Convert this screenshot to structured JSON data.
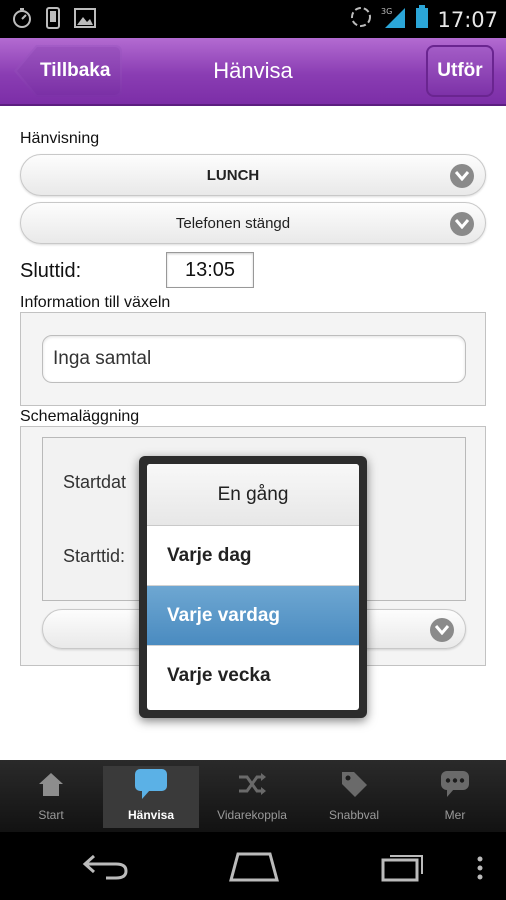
{
  "status_bar": {
    "time": "17:07",
    "network": "3G",
    "left_icons": [
      "speedometer-icon",
      "phone-icon",
      "image-icon"
    ]
  },
  "header": {
    "back_label": "Tillbaka",
    "title": "Hänvisa",
    "done_label": "Utför"
  },
  "form": {
    "hanvisning_label": "Hänvisning",
    "reason_value": "LUNCH",
    "phone_state_value": "Telefonen stängd",
    "sluttid_label": "Sluttid:",
    "sluttid_value": "13:05",
    "info_label": "Information till växeln",
    "info_value": "Inga samtal",
    "schema_label": "Schemaläggning",
    "startdatum_label": "Startdat",
    "starttid_label": "Starttid:"
  },
  "popup": {
    "header": "En gång",
    "options": [
      "Varje dag",
      "Varje vardag",
      "Varje vecka"
    ],
    "selected": "Varje vardag"
  },
  "tabs": [
    {
      "label": "Start",
      "icon": "home-icon"
    },
    {
      "label": "Hänvisa",
      "icon": "speech-bubble-icon",
      "active": true
    },
    {
      "label": "Vidarekoppla",
      "icon": "shuffle-icon"
    },
    {
      "label": "Snabbval",
      "icon": "tag-icon"
    },
    {
      "label": "Mer",
      "icon": "chat-dots-icon"
    }
  ],
  "colors": {
    "header_purple": "#8a3db3",
    "selected_blue": "#4a8bc0"
  }
}
